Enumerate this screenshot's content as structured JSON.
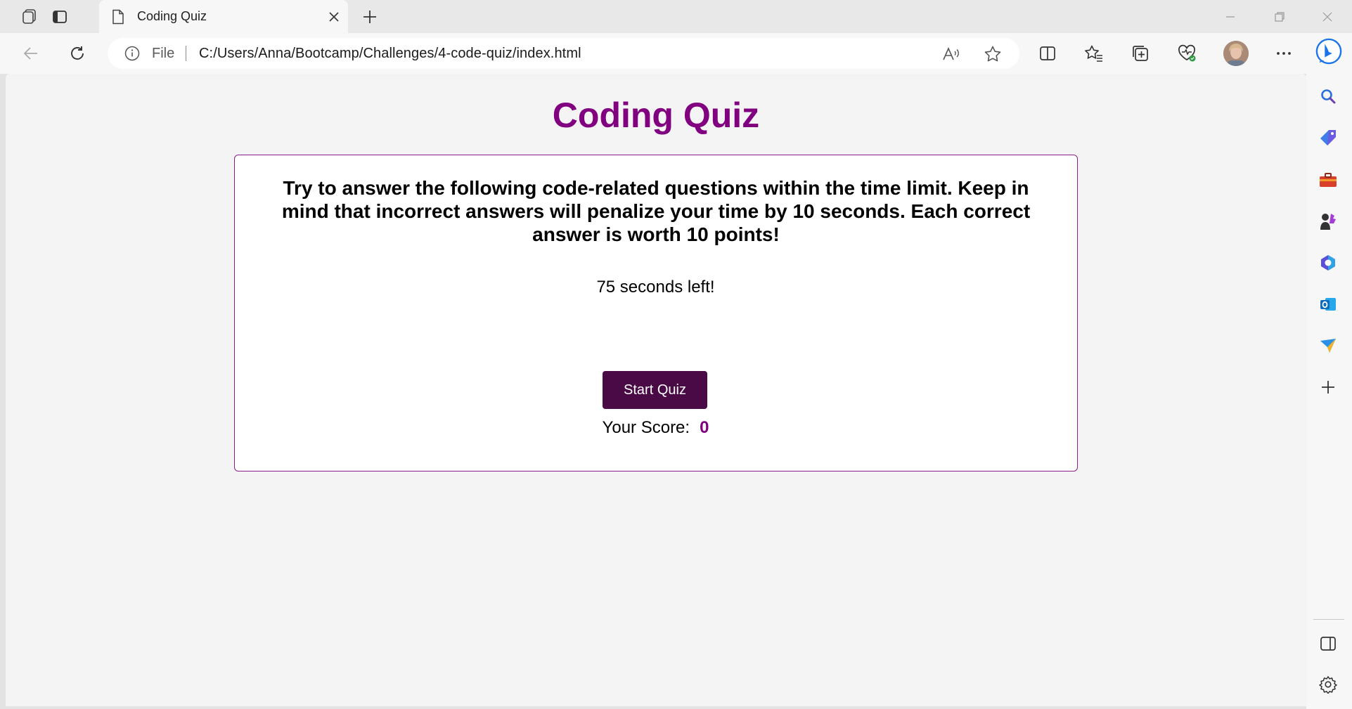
{
  "browser": {
    "tab_title": "Coding Quiz",
    "address": {
      "scheme_label": "File",
      "url": "C:/Users/Anna/Bootcamp/Challenges/4-code-quiz/index.html"
    },
    "accent_color": "#1a73e8"
  },
  "page": {
    "title": "Coding Quiz",
    "intro_text": "Try to answer the following code-related questions within the time limit. Keep in mind that incorrect answers will penalize your time by 10 seconds. Each correct answer is worth 10 points!",
    "timer_text": "75 seconds left!",
    "start_button_label": "Start Quiz",
    "score_label": "Your Score:",
    "score_value": "0",
    "colors": {
      "title": "#800080",
      "button": "#4a0a45",
      "card_border": "#8b1e8b"
    }
  },
  "icons": {
    "tab_bar": [
      "workspaces-icon",
      "tab-actions-icon",
      "document-icon",
      "close-icon",
      "plus-icon"
    ],
    "toolbar": [
      "back-arrow-icon",
      "refresh-icon",
      "info-icon",
      "read-aloud-icon",
      "star-icon",
      "split-screen-icon",
      "favorites-icon",
      "collections-icon",
      "browser-essentials-icon",
      "more-icon",
      "bing-copilot-icon"
    ],
    "sidebar": [
      "search-icon",
      "shopping-tag-icon",
      "tools-icon",
      "games-icon",
      "microsoft-365-icon",
      "outlook-icon",
      "send-icon",
      "plus-icon",
      "sidebar-toggle-icon",
      "settings-gear-icon"
    ]
  }
}
